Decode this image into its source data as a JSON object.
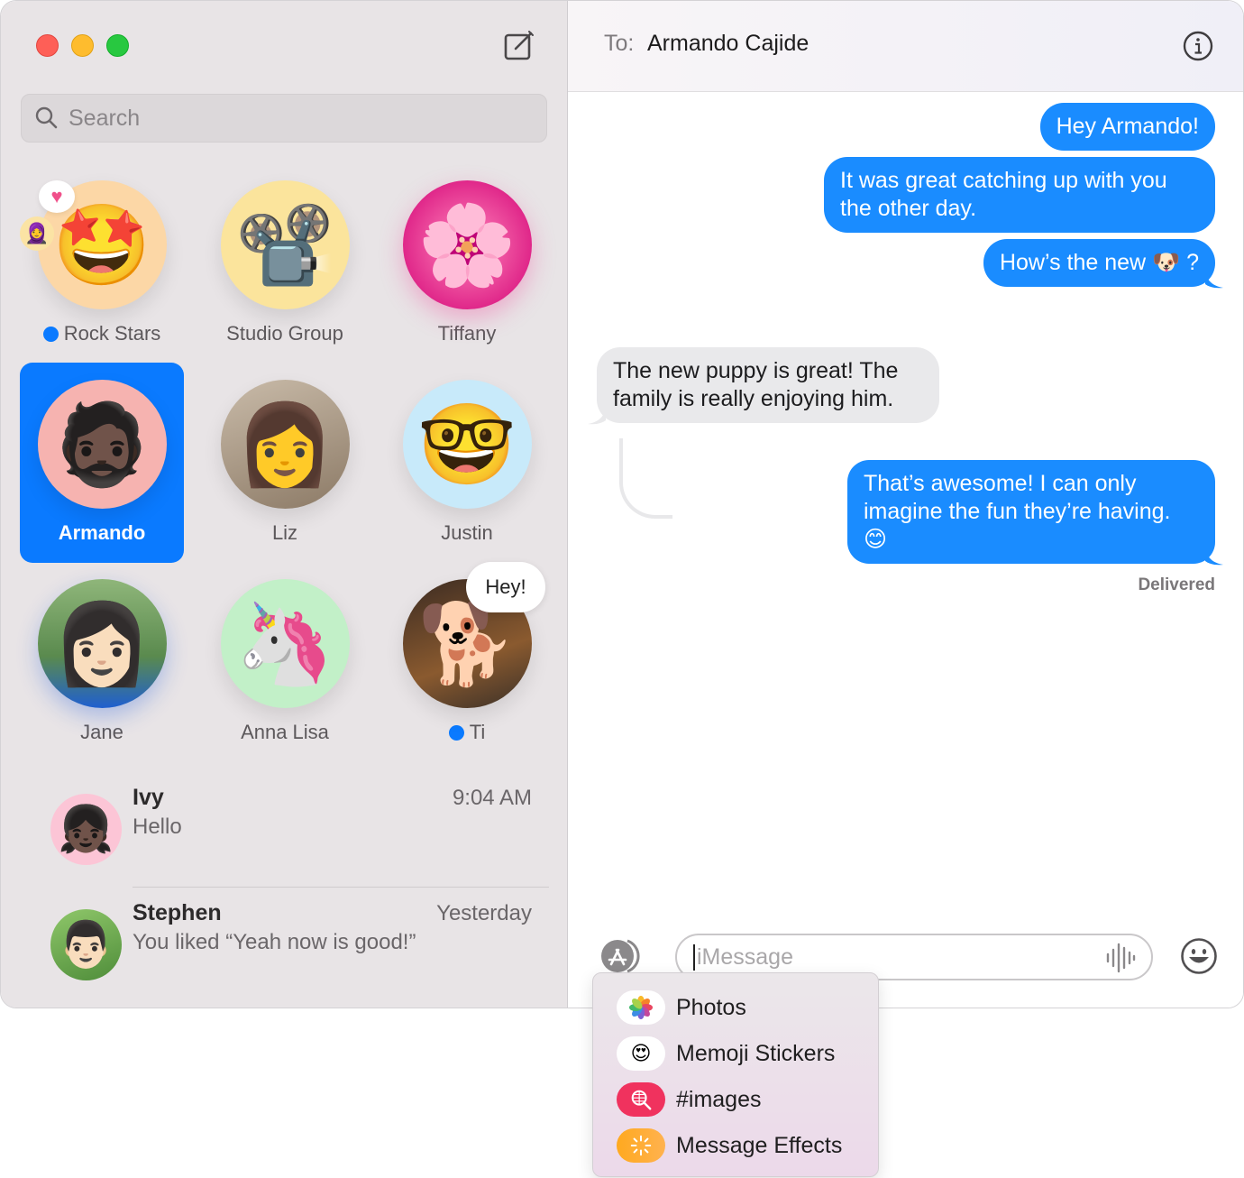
{
  "window": {
    "traffic_lights": [
      "close",
      "minimize",
      "zoom"
    ]
  },
  "sidebar": {
    "compose_icon": "compose-icon",
    "search": {
      "placeholder": "Search",
      "value": ""
    },
    "pinned": [
      {
        "name": "Rock Stars",
        "unread": true,
        "avatar": "🤩",
        "bg": "#fcd4a0",
        "reaction": "♥",
        "reaction_avatar": "🧕"
      },
      {
        "name": "Studio Group",
        "unread": false,
        "avatar": "📽️",
        "bg": "#fbe49c"
      },
      {
        "name": "Tiffany",
        "unread": false,
        "avatar": "🌸",
        "bg": "#e83e9a"
      },
      {
        "name": "Armando",
        "unread": false,
        "avatar": "🧔🏿",
        "bg": "#f6b3b0",
        "selected": true
      },
      {
        "name": "Liz",
        "unread": false,
        "avatar": "👩",
        "bg": "#b9a89a"
      },
      {
        "name": "Justin",
        "unread": false,
        "avatar": "🤓",
        "bg": "#c8eafa"
      },
      {
        "name": "Jane",
        "unread": false,
        "avatar": "👩🏻",
        "bg": "#6a9a5c"
      },
      {
        "name": "Anna Lisa",
        "unread": false,
        "avatar": "🦄",
        "bg": "#c2f0c8"
      },
      {
        "name": "Ti",
        "unread": true,
        "avatar": "🐕",
        "bg": "#6e4e33",
        "bubble": "Hey!"
      }
    ],
    "conversations": [
      {
        "name": "Ivy",
        "time": "9:04 AM",
        "preview": "Hello",
        "avatar": "👧🏿",
        "bg": "#fcc5d6"
      },
      {
        "name": "Stephen",
        "time": "Yesterday",
        "preview": "You liked “Yeah now is good!”",
        "avatar": "👨🏻",
        "bg": "#7bb35a"
      }
    ]
  },
  "chat": {
    "to_label": "To:",
    "recipient": "Armando Cajide",
    "messages": [
      {
        "direction": "outgoing",
        "text": "Hey Armando!"
      },
      {
        "direction": "outgoing",
        "text": "It was great catching up with you the other day."
      },
      {
        "direction": "outgoing",
        "text": "How’s the new 🐶 ?"
      },
      {
        "direction": "incoming",
        "text": "The new puppy is great! The family is really enjoying him."
      },
      {
        "direction": "outgoing",
        "text": "That’s awesome! I can only imagine the fun they’re having. 😊"
      }
    ],
    "status": "Delivered",
    "input": {
      "placeholder": "iMessage",
      "value": ""
    }
  },
  "apps_menu": {
    "items": [
      {
        "label": "Photos",
        "icon": "photos-icon",
        "glyph": "✿",
        "bg": "#ffffff",
        "fg": "#e85d8a"
      },
      {
        "label": "Memoji Stickers",
        "icon": "memoji-stickers-icon",
        "glyph": "😍",
        "bg": "#ffffff",
        "fg": "#333"
      },
      {
        "label": "#images",
        "icon": "images-search-icon",
        "glyph": "🔍",
        "bg": "#f0325e",
        "fg": "#ffffff"
      },
      {
        "label": "Message Effects",
        "icon": "message-effects-icon",
        "glyph": "✨",
        "bg": "#ffab2e",
        "fg": "#ffffff"
      }
    ]
  }
}
